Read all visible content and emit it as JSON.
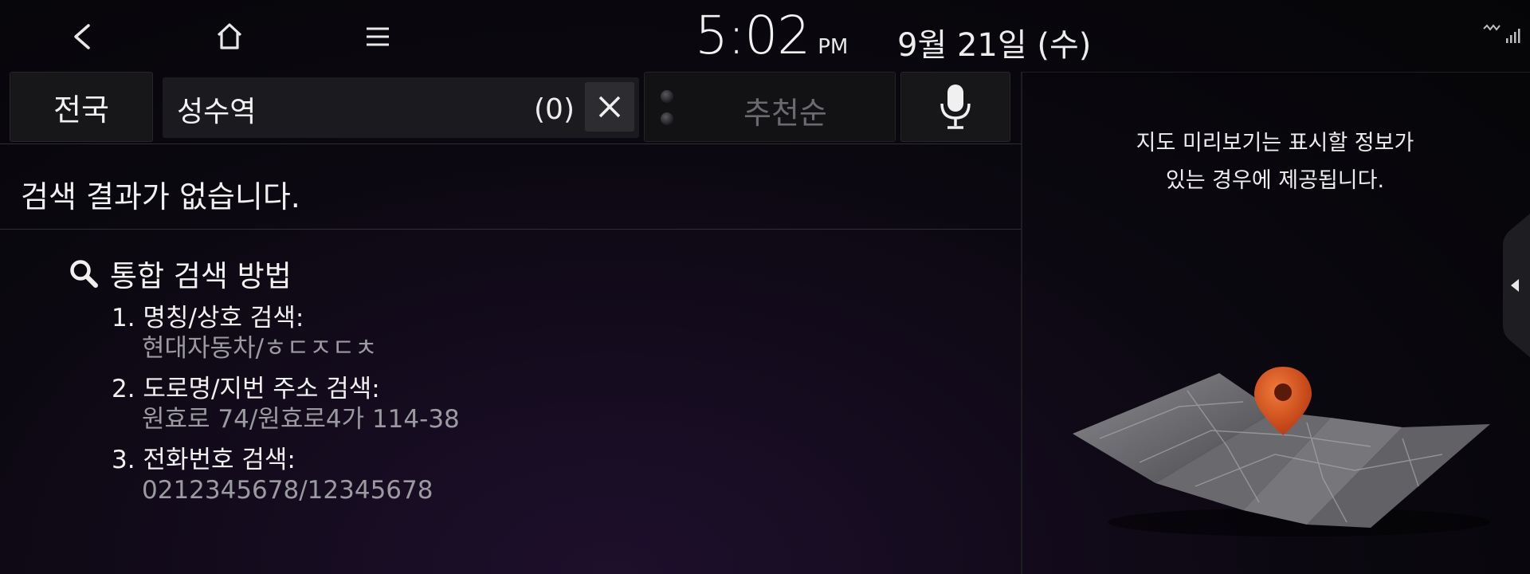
{
  "status_bar": {
    "back_icon": "chevron-left-icon",
    "home_icon": "home-icon",
    "menu_icon": "hamburger-menu-icon",
    "time": "5:02",
    "ampm": "PM",
    "date": "9월 21일 (수)",
    "brand_icon": "brand-logo-icon",
    "signal_icon": "signal-strength-icon"
  },
  "search_bar": {
    "region_label": "전국",
    "query": "성수역",
    "result_count": "(0)",
    "clear_icon": "close-icon",
    "sort_label": "추천순",
    "mic_icon": "microphone-icon"
  },
  "results": {
    "empty_message": "검색 결과가 없습니다.",
    "guide_title": "통합 검색 방법",
    "guide_icon": "search-icon",
    "guide_items": [
      {
        "label": "1. 명칭/상호 검색:",
        "example": "현대자동차/ㅎㄷㅈㄷㅊ"
      },
      {
        "label": "2. 도로명/지번 주소 검색:",
        "example": "원효로 74/원효로4가 114-38"
      },
      {
        "label": "3. 전화번호 검색:",
        "example": "0212345678/12345678"
      }
    ]
  },
  "preview": {
    "message_line1": "지도 미리보기는 표시할 정보가",
    "message_line2": "있는 경우에 제공됩니다.",
    "illustration_icon": "folded-map-with-pin-icon",
    "side_tab_icon": "triangle-left-icon"
  },
  "colors": {
    "background": "#0b0810",
    "pin": "#d9501c",
    "text_primary": "#f0f0f0",
    "text_secondary": "#9a9aa0",
    "disabled": "#6a6a70"
  }
}
